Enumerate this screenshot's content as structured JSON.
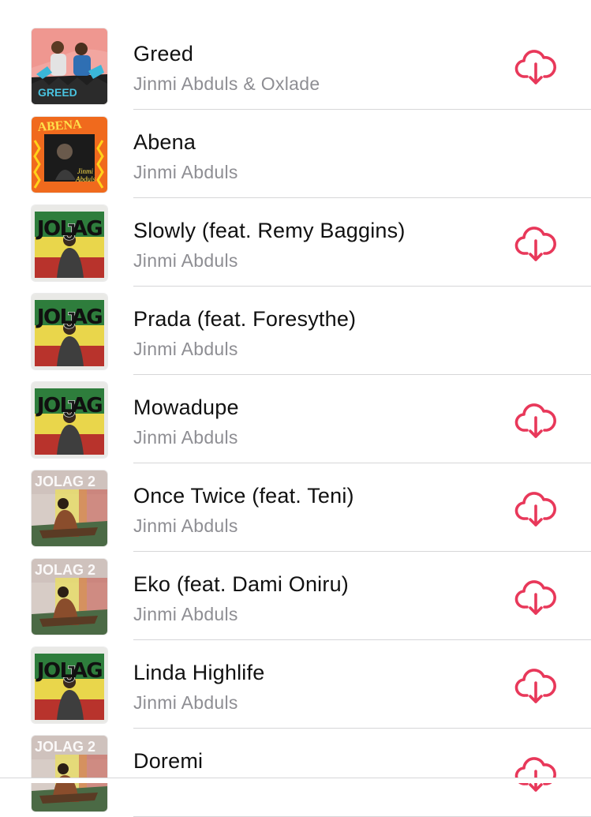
{
  "colors": {
    "accent": "#e8385a",
    "title": "#111111",
    "subtitle": "#8e8e93",
    "separator": "#d6d6d8"
  },
  "songs": [
    {
      "title": "Greed",
      "artist": "Jinmi Abduls & Oxlade",
      "artwork": "greed",
      "art_text": "GREED",
      "download_icon": "download-cloud-icon",
      "downloadable": true
    },
    {
      "title": "Abena",
      "artist": "Jinmi Abduls",
      "artwork": "abena",
      "art_text": "ABENA",
      "art_subtext": "Jinmi Abduls",
      "download_icon": "download-cloud-icon",
      "downloadable": false
    },
    {
      "title": "Slowly (feat. Remy Baggins)",
      "artist": "Jinmi Abduls",
      "artwork": "jolag",
      "art_text": "JOLAG",
      "download_icon": "download-cloud-icon",
      "downloadable": true
    },
    {
      "title": "Prada (feat. Foresythe)",
      "artist": "Jinmi Abduls",
      "artwork": "jolag",
      "art_text": "JOLAG",
      "download_icon": "download-cloud-icon",
      "downloadable": false
    },
    {
      "title": "Mowadupe",
      "artist": "Jinmi Abduls",
      "artwork": "jolag",
      "art_text": "JOLAG",
      "download_icon": "download-cloud-icon",
      "downloadable": true
    },
    {
      "title": "Once Twice (feat. Teni)",
      "artist": "Jinmi Abduls",
      "artwork": "jolag2",
      "art_text": "JOLAG 2",
      "download_icon": "download-cloud-icon",
      "downloadable": true
    },
    {
      "title": "Eko (feat. Dami Oniru)",
      "artist": "Jinmi Abduls",
      "artwork": "jolag2",
      "art_text": "JOLAG 2",
      "download_icon": "download-cloud-icon",
      "downloadable": true
    },
    {
      "title": "Linda Highlife",
      "artist": "Jinmi Abduls",
      "artwork": "jolag",
      "art_text": "JOLAG",
      "download_icon": "download-cloud-icon",
      "downloadable": true
    },
    {
      "title": "Doremi",
      "artist": "",
      "artwork": "jolag2",
      "art_text": "JOLAG 2",
      "download_icon": "download-cloud-icon",
      "downloadable": true
    }
  ]
}
